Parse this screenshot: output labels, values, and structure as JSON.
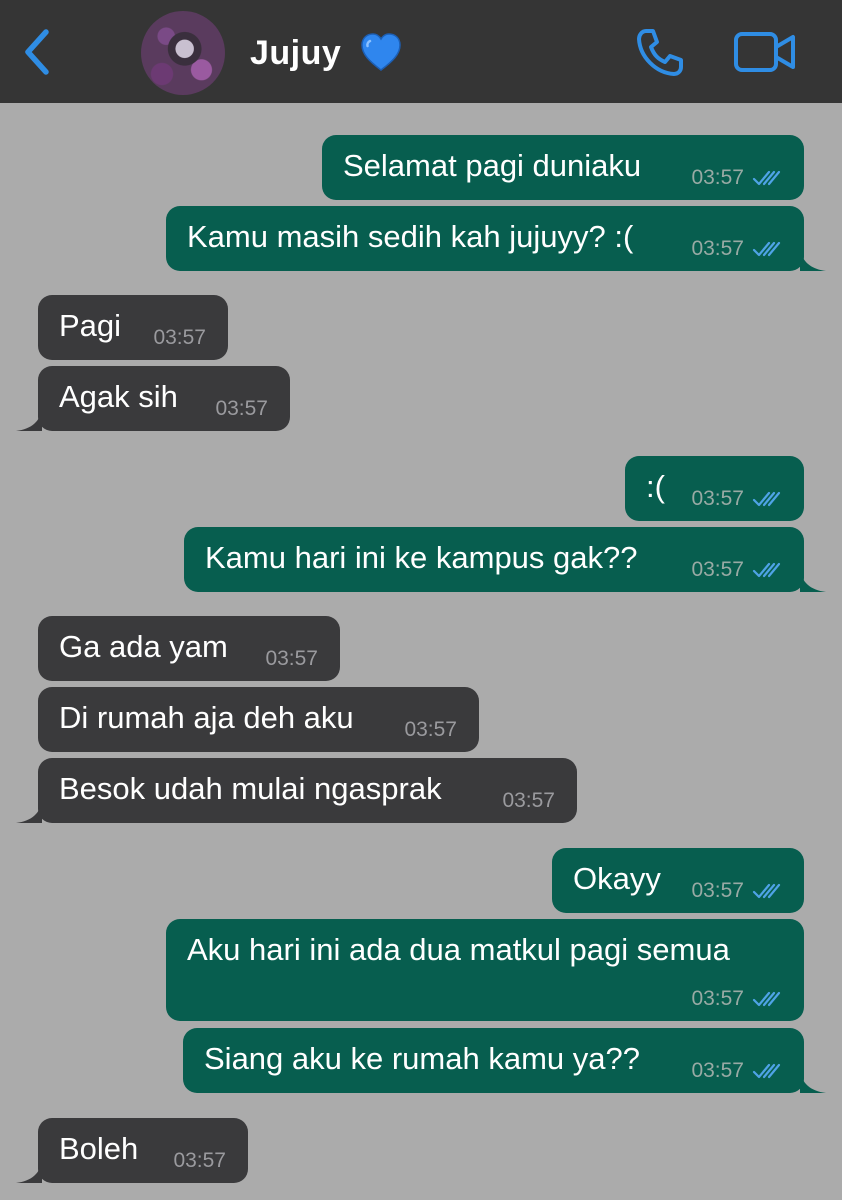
{
  "header": {
    "contact_name": "Jujuy",
    "back_icon": "chevron-left-icon",
    "call_icon": "phone-icon",
    "video_icon": "video-camera-icon",
    "accent_color": "#2f8de4",
    "heart": "💙"
  },
  "colors": {
    "background": "#ababab",
    "header": "#353535",
    "outgoing_bubble": "#075e4f",
    "incoming_bubble": "#3a3a3c",
    "read_ticks": "#4fa3e6"
  },
  "messages": [
    {
      "dir": "out",
      "text": "Selamat pagi duniaku",
      "time": "03:57",
      "status": "read"
    },
    {
      "dir": "out",
      "text": "Kamu masih sedih kah jujuyy? :(",
      "time": "03:57",
      "status": "read"
    },
    {
      "dir": "in",
      "text": "Pagi",
      "time": "03:57"
    },
    {
      "dir": "in",
      "text": "Agak sih",
      "time": "03:57"
    },
    {
      "dir": "out",
      "text": ":(",
      "time": "03:57",
      "status": "read"
    },
    {
      "dir": "out",
      "text": "Kamu hari ini ke kampus gak??",
      "time": "03:57",
      "status": "read"
    },
    {
      "dir": "in",
      "text": "Ga ada yam",
      "time": "03:57"
    },
    {
      "dir": "in",
      "text": "Di rumah aja deh aku",
      "time": "03:57"
    },
    {
      "dir": "in",
      "text": "Besok udah mulai ngasprak",
      "time": "03:57"
    },
    {
      "dir": "out",
      "text": "Okayy",
      "time": "03:57",
      "status": "read"
    },
    {
      "dir": "out",
      "text": "Aku hari ini ada dua matkul pagi semua",
      "time": "03:57",
      "status": "read"
    },
    {
      "dir": "out",
      "text": "Siang aku ke rumah kamu ya??",
      "time": "03:57",
      "status": "read"
    },
    {
      "dir": "in",
      "text": "Boleh",
      "time": "03:57"
    }
  ]
}
